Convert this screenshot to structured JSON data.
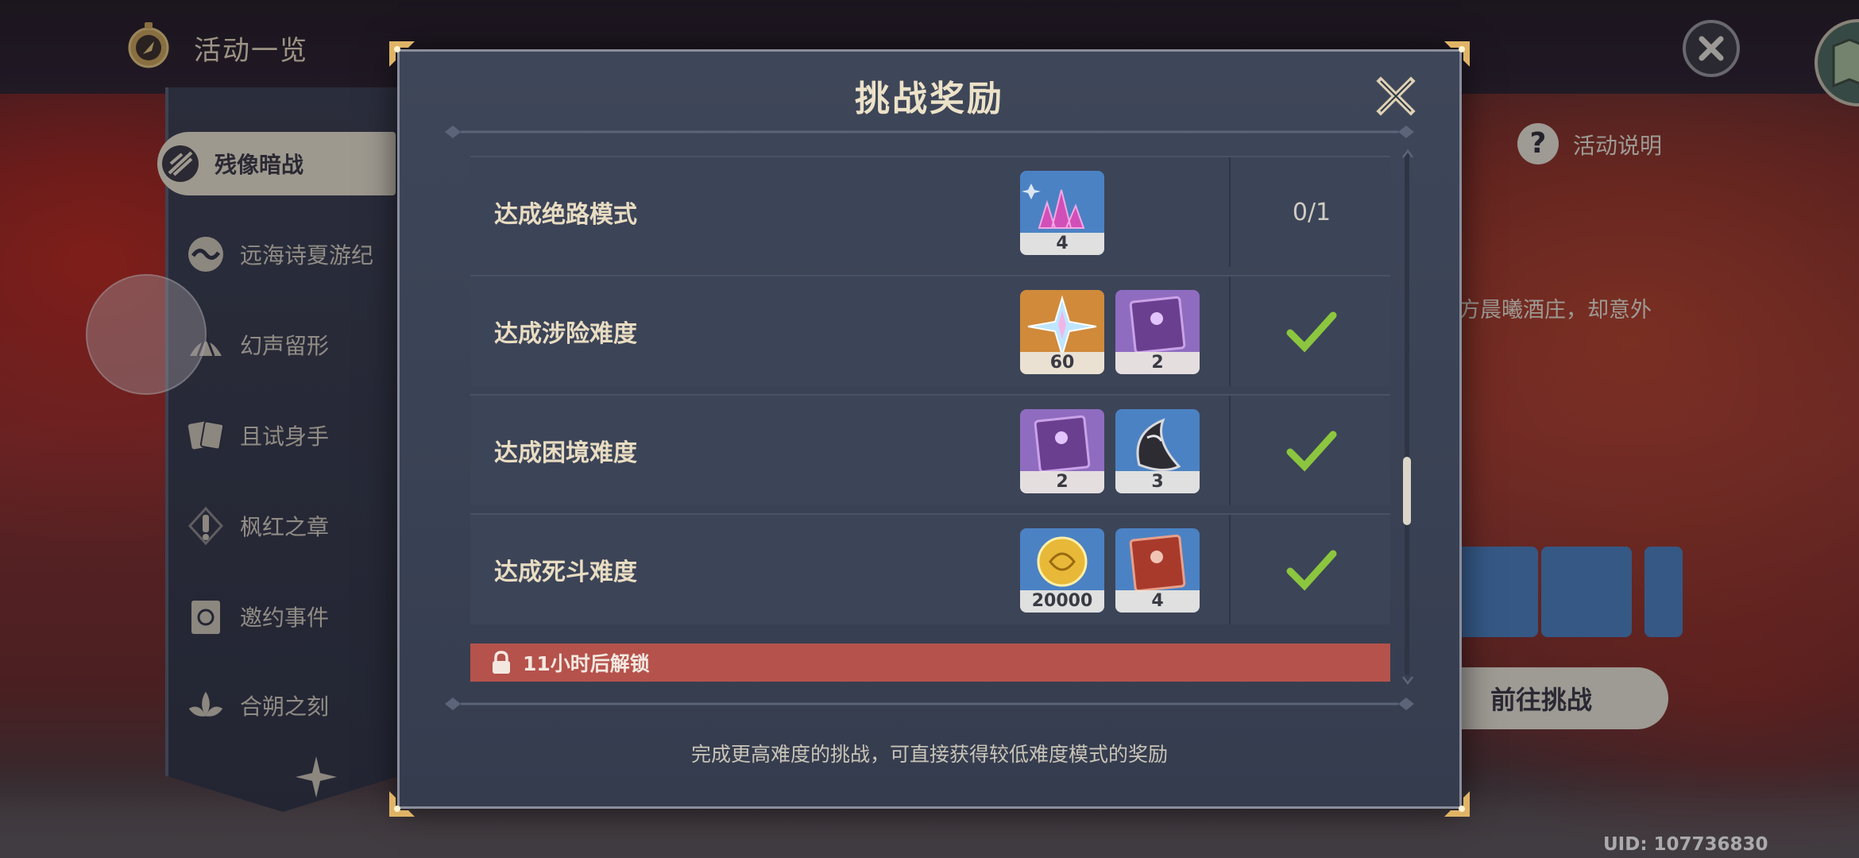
{
  "header": {
    "title": "活动一览"
  },
  "sidebar": {
    "items": [
      {
        "label": "残像暗战",
        "icon": "battle-icon",
        "active": true
      },
      {
        "label": "远海诗夏游纪",
        "icon": "wave-icon",
        "active": false
      },
      {
        "label": "幻声留形",
        "icon": "shell-icon",
        "active": false
      },
      {
        "label": "且试身手",
        "icon": "cards-icon",
        "active": false
      },
      {
        "label": "枫红之章",
        "icon": "exclamation-icon",
        "active": false
      },
      {
        "label": "邀约事件",
        "icon": "book-icon",
        "active": false
      },
      {
        "label": "合朔之刻",
        "icon": "lotus-icon",
        "active": false
      }
    ]
  },
  "background": {
    "help_label": "活动说明",
    "description_fragment": "方晨曦酒庄，却意外",
    "goto_button": "前往挑战",
    "uid": "UID: 107736830"
  },
  "modal": {
    "title": "挑战奖励",
    "rows": [
      {
        "label": "达成绝路模式",
        "rewards": [
          {
            "icon": "crystal-icon",
            "count": "4",
            "bg": "#4b82c4"
          }
        ],
        "status": "0/1",
        "completed": false
      },
      {
        "label": "达成涉险难度",
        "rewards": [
          {
            "icon": "primogem-icon",
            "count": "60",
            "bg": "#d08a3a"
          },
          {
            "icon": "purple-book-icon",
            "count": "2",
            "bg": "#8f6cc0"
          }
        ],
        "completed": true
      },
      {
        "label": "达成困境难度",
        "rewards": [
          {
            "icon": "purple-book-icon",
            "count": "2",
            "bg": "#8f6cc0"
          },
          {
            "icon": "horn-icon",
            "count": "3",
            "bg": "#4b82c4"
          }
        ],
        "completed": true
      },
      {
        "label": "达成死斗难度",
        "rewards": [
          {
            "icon": "mora-icon",
            "count": "20000",
            "bg": "#4b82c4"
          },
          {
            "icon": "red-book-icon",
            "count": "4",
            "bg": "#4b82c4"
          }
        ],
        "completed": true
      }
    ],
    "locked_text": "11小时后解锁",
    "footer": "完成更高难度的挑战，可直接获得较低难度模式的奖励"
  },
  "colors": {
    "check_green": "#8cc63f",
    "lock_bar": "#b5524c",
    "title_gold": "#ece2c8"
  }
}
